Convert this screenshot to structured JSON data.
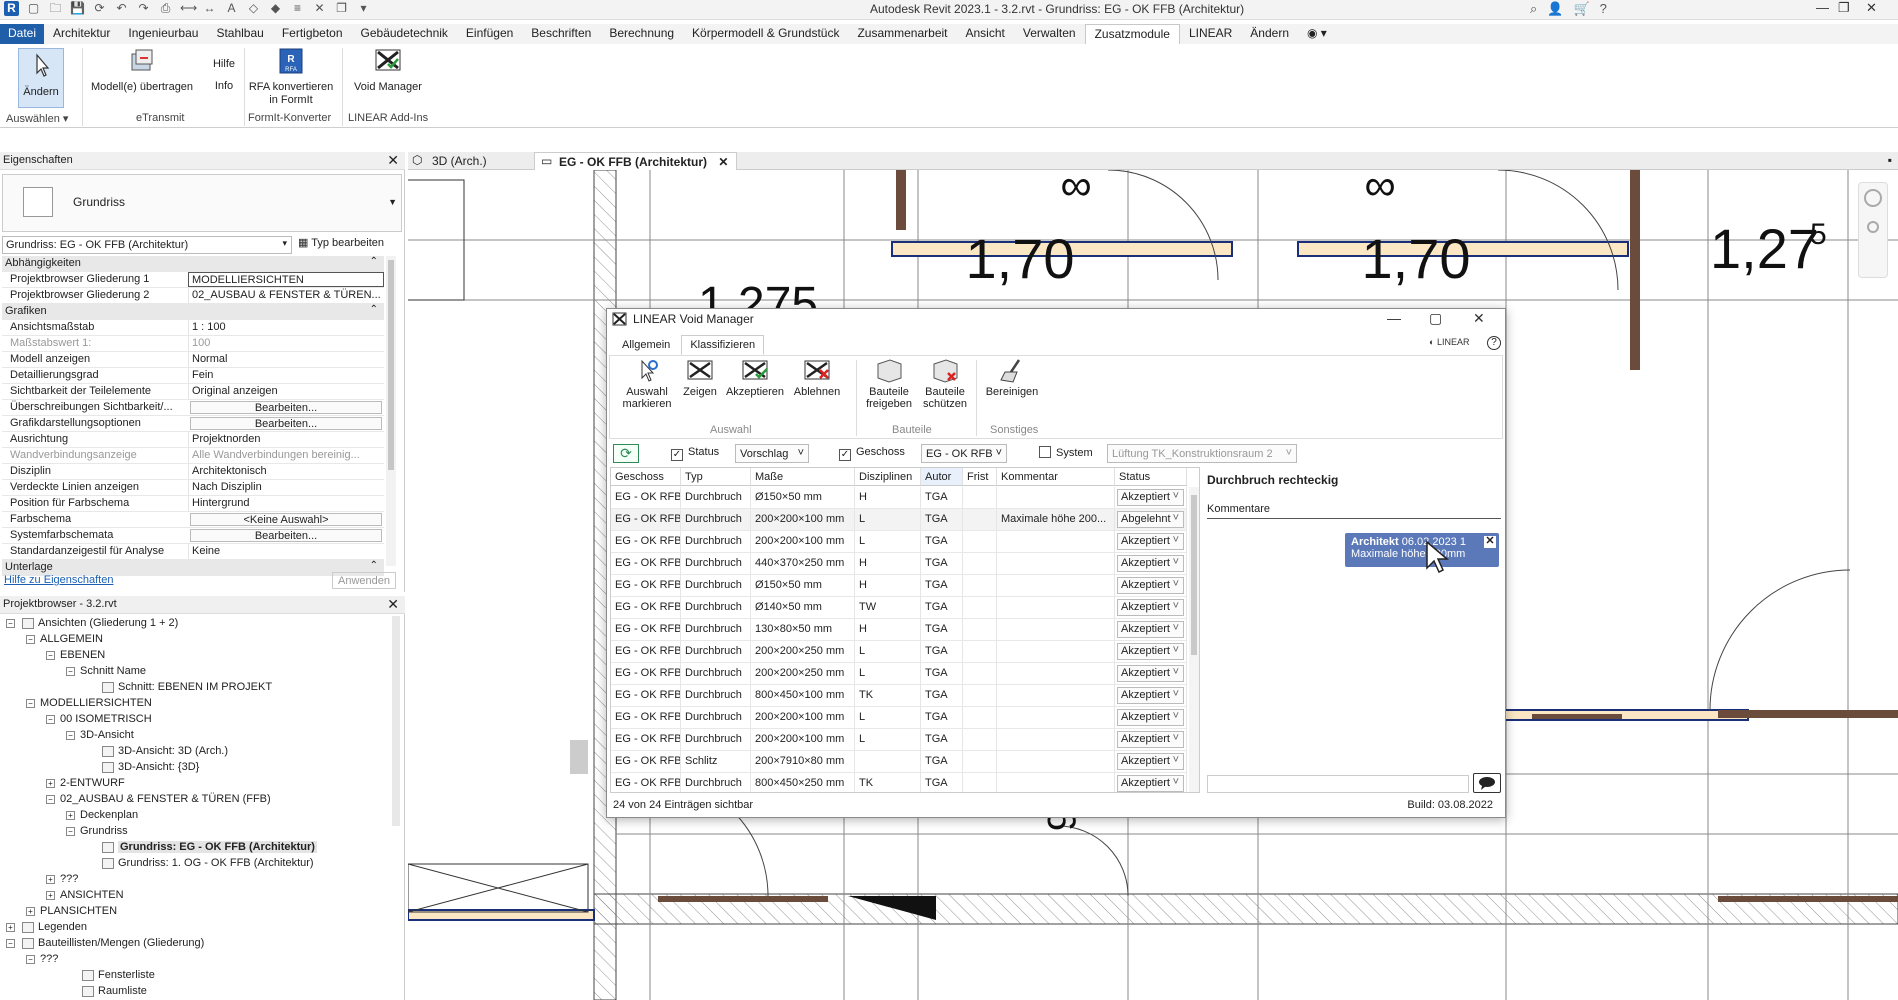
{
  "app": {
    "title": "Autodesk Revit 2023.1 - 3.2.rvt - Grundriss: EG - OK FFB (Architektur)",
    "logo": "R"
  },
  "ribbon_tabs": [
    "Datei",
    "Architektur",
    "Ingenieurbau",
    "Stahlbau",
    "Fertigbeton",
    "Gebäudetechnik",
    "Einfügen",
    "Beschriften",
    "Berechnung",
    "Körpermodell & Grundstück",
    "Zusammenarbeit",
    "Ansicht",
    "Verwalten",
    "Zusatzmodule",
    "LINEAR",
    "Ändern"
  ],
  "ribbon": {
    "aendern": "Ändern",
    "auswaehlen": "Auswählen",
    "modell_uebertragen": "Modell(e) übertragen",
    "hilfe": "Hilfe",
    "info": "Info",
    "etransmit": "eTransmit",
    "rfa_line1": "RFA konvertieren",
    "rfa_line2": "in FormIt",
    "formit_konverter": "FormIt-Konverter",
    "void_manager": "Void Manager",
    "linear_addins": "LINEAR Add-Ins"
  },
  "properties": {
    "header": "Eigenschaften",
    "type_name": "Grundriss",
    "instance": "Grundriss: EG - OK FFB (Architektur)",
    "type_edit": "Typ bearbeiten",
    "rows": [
      {
        "k": "Abhängigkeiten",
        "v": "",
        "section": true
      },
      {
        "k": "Projektbrowser Gliederung 1",
        "v": "MODELLIERSICHTEN",
        "sel": true
      },
      {
        "k": "Projektbrowser Gliederung 2",
        "v": "02_AUSBAU & FENSTER & TÜREN..."
      },
      {
        "k": "Grafiken",
        "v": "",
        "section": true
      },
      {
        "k": "Ansichtsmaßstab",
        "v": "1 : 100"
      },
      {
        "k": "Maßstabswert 1:",
        "v": "100",
        "grey": true
      },
      {
        "k": "Modell anzeigen",
        "v": "Normal"
      },
      {
        "k": "Detaillierungsgrad",
        "v": "Fein"
      },
      {
        "k": "Sichtbarkeit der Teilelemente",
        "v": "Original anzeigen"
      },
      {
        "k": "Überschreibungen Sichtbarkeit/...",
        "v": "Bearbeiten...",
        "btn": true
      },
      {
        "k": "Grafikdarstellungsoptionen",
        "v": "Bearbeiten...",
        "btn": true
      },
      {
        "k": "Ausrichtung",
        "v": "Projektnorden"
      },
      {
        "k": "Wandverbindungsanzeige",
        "v": "Alle Wandverbindungen bereinig...",
        "grey": true
      },
      {
        "k": "Disziplin",
        "v": "Architektonisch"
      },
      {
        "k": "Verdeckte Linien anzeigen",
        "v": "Nach Disziplin"
      },
      {
        "k": "Position für Farbschema",
        "v": "Hintergrund"
      },
      {
        "k": "Farbschema",
        "v": "<Keine Auswahl>",
        "btn": true
      },
      {
        "k": "Systemfarbschemata",
        "v": "Bearbeiten...",
        "btn": true
      },
      {
        "k": "Standardanzeigestil für Analyse",
        "v": "Keine"
      },
      {
        "k": "Unterlage",
        "v": "",
        "section": true
      }
    ],
    "help_link": "Hilfe zu Eigenschaften",
    "apply": "Anwenden"
  },
  "browser": {
    "header": "Projektbrowser - 3.2.rvt",
    "items": [
      {
        "t": "Ansichten (Gliederung 1 + 2)",
        "lvl": 0,
        "tg": "-",
        "ic": true
      },
      {
        "t": "ALLGEMEIN",
        "lvl": 1,
        "tg": "-"
      },
      {
        "t": "EBENEN",
        "lvl": 2,
        "tg": "-"
      },
      {
        "t": "Schnitt Name",
        "lvl": 3,
        "tg": "-"
      },
      {
        "t": "Schnitt: EBENEN IM PROJEKT",
        "lvl": 4,
        "tg": "",
        "ic": true
      },
      {
        "t": "MODELLIERSICHTEN",
        "lvl": 1,
        "tg": "-"
      },
      {
        "t": "00 ISOMETRISCH",
        "lvl": 2,
        "tg": "-"
      },
      {
        "t": "3D-Ansicht",
        "lvl": 3,
        "tg": "-"
      },
      {
        "t": "3D-Ansicht: 3D (Arch.)",
        "lvl": 4,
        "tg": "",
        "ic": true
      },
      {
        "t": "3D-Ansicht: {3D}",
        "lvl": 4,
        "tg": "",
        "ic": true
      },
      {
        "t": "2-ENTWURF",
        "lvl": 2,
        "tg": "+"
      },
      {
        "t": "02_AUSBAU & FENSTER & TÜREN (FFB)",
        "lvl": 2,
        "tg": "-"
      },
      {
        "t": "Deckenplan",
        "lvl": 3,
        "tg": "+"
      },
      {
        "t": "Grundriss",
        "lvl": 3,
        "tg": "-"
      },
      {
        "t": "Grundriss: EG - OK FFB (Architektur)",
        "lvl": 4,
        "tg": "",
        "ic": true,
        "bold": true
      },
      {
        "t": "Grundriss: 1. OG - OK FFB (Architektur)",
        "lvl": 4,
        "tg": "",
        "ic": true
      },
      {
        "t": "???",
        "lvl": 2,
        "tg": "+"
      },
      {
        "t": "ANSICHTEN",
        "lvl": 2,
        "tg": "+"
      },
      {
        "t": "PLANSICHTEN",
        "lvl": 1,
        "tg": "+"
      },
      {
        "t": "Legenden",
        "lvl": 0,
        "tg": "+",
        "ic": true
      },
      {
        "t": "Bauteillisten/Mengen (Gliederung)",
        "lvl": 0,
        "tg": "-",
        "ic": true
      },
      {
        "t": "???",
        "lvl": 1,
        "tg": "-"
      },
      {
        "t": "Fensterliste",
        "lvl": 3,
        "tg": "",
        "ic": true
      },
      {
        "t": "Raumliste",
        "lvl": 3,
        "tg": "",
        "ic": true
      }
    ]
  },
  "view_tabs": {
    "tab1": "3D (Arch.)",
    "tab2": "EG - OK FFB (Architektur)"
  },
  "canvas": {
    "dim1": "1,70",
    "dim2": "1,70",
    "dim3": "1,27",
    "dim3_sup": "5",
    "dim4": "1,275",
    "mark_inf": "∞",
    "mark6": "6"
  },
  "void_manager": {
    "title": "LINEAR Void Manager",
    "tabs": [
      "Allgemein",
      "Klassifizieren"
    ],
    "logo_text": "LINEAR",
    "buttons": {
      "auswahl_markieren_1": "Auswahl",
      "auswahl_markieren_2": "markieren",
      "zeigen": "Zeigen",
      "akzeptieren": "Akzeptieren",
      "ablehnen": "Ablehnen",
      "freigeben_1": "Bauteile",
      "freigeben_2": "freigeben",
      "schuetzen_1": "Bauteile",
      "schuetzen_2": "schützen",
      "bereinigen": "Bereinigen"
    },
    "groups": {
      "auswahl": "Auswahl",
      "bauteile": "Bauteile",
      "sonstiges": "Sonstiges"
    },
    "filters": {
      "status_label": "Status",
      "status_value": "Vorschlag",
      "geschoss_label": "Geschoss",
      "geschoss_value": "EG - OK RFB",
      "system_label": "System",
      "system_value": "Lüftung TK_Konstruktionsraum 2"
    },
    "columns": [
      "Geschoss",
      "Typ",
      "Maße",
      "Disziplinen",
      "Autor",
      "Frist",
      "Kommentar",
      "Status"
    ],
    "rows": [
      [
        "EG - OK RFB",
        "Durchbruch",
        "Ø150×50 mm",
        "H",
        "TGA",
        "",
        "",
        "Akzeptiert"
      ],
      [
        "EG - OK RFB",
        "Durchbruch",
        "200×200×100 mm",
        "L",
        "TGA",
        "",
        "Maximale höhe 200...",
        "Abgelehnt"
      ],
      [
        "EG - OK RFB",
        "Durchbruch",
        "200×200×100 mm",
        "L",
        "TGA",
        "",
        "",
        "Akzeptiert"
      ],
      [
        "EG - OK RFB",
        "Durchbruch",
        "440×370×250 mm",
        "H",
        "TGA",
        "",
        "",
        "Akzeptiert"
      ],
      [
        "EG - OK RFB",
        "Durchbruch",
        "Ø150×50 mm",
        "H",
        "TGA",
        "",
        "",
        "Akzeptiert"
      ],
      [
        "EG - OK RFB",
        "Durchbruch",
        "Ø140×50 mm",
        "TW",
        "TGA",
        "",
        "",
        "Akzeptiert"
      ],
      [
        "EG - OK RFB",
        "Durchbruch",
        "130×80×50 mm",
        "H",
        "TGA",
        "",
        "",
        "Akzeptiert"
      ],
      [
        "EG - OK RFB",
        "Durchbruch",
        "200×200×250 mm",
        "L",
        "TGA",
        "",
        "",
        "Akzeptiert"
      ],
      [
        "EG - OK RFB",
        "Durchbruch",
        "200×200×250 mm",
        "L",
        "TGA",
        "",
        "",
        "Akzeptiert"
      ],
      [
        "EG - OK RFB",
        "Durchbruch",
        "800×450×100 mm",
        "TK",
        "TGA",
        "",
        "",
        "Akzeptiert"
      ],
      [
        "EG - OK RFB",
        "Durchbruch",
        "200×200×100 mm",
        "L",
        "TGA",
        "",
        "",
        "Akzeptiert"
      ],
      [
        "EG - OK RFB",
        "Durchbruch",
        "200×200×100 mm",
        "L",
        "TGA",
        "",
        "",
        "Akzeptiert"
      ],
      [
        "EG - OK RFB",
        "Schlitz",
        "200×7910×80 mm",
        "",
        "TGA",
        "",
        "",
        "Akzeptiert"
      ],
      [
        "EG - OK RFB",
        "Durchbruch",
        "800×450×250 mm",
        "TK",
        "TGA",
        "",
        "",
        "Akzeptiert"
      ]
    ],
    "detail": {
      "title": "Durchbruch rechteckig",
      "comments_label": "Kommentare",
      "comment_author": "Architekt",
      "comment_date": "06.02.2023 1",
      "comment_text": "Maximale höhe 200mm"
    },
    "footer_count": "24 von 24 Einträgen sichtbar",
    "build": "Build: 03.08.2022"
  }
}
